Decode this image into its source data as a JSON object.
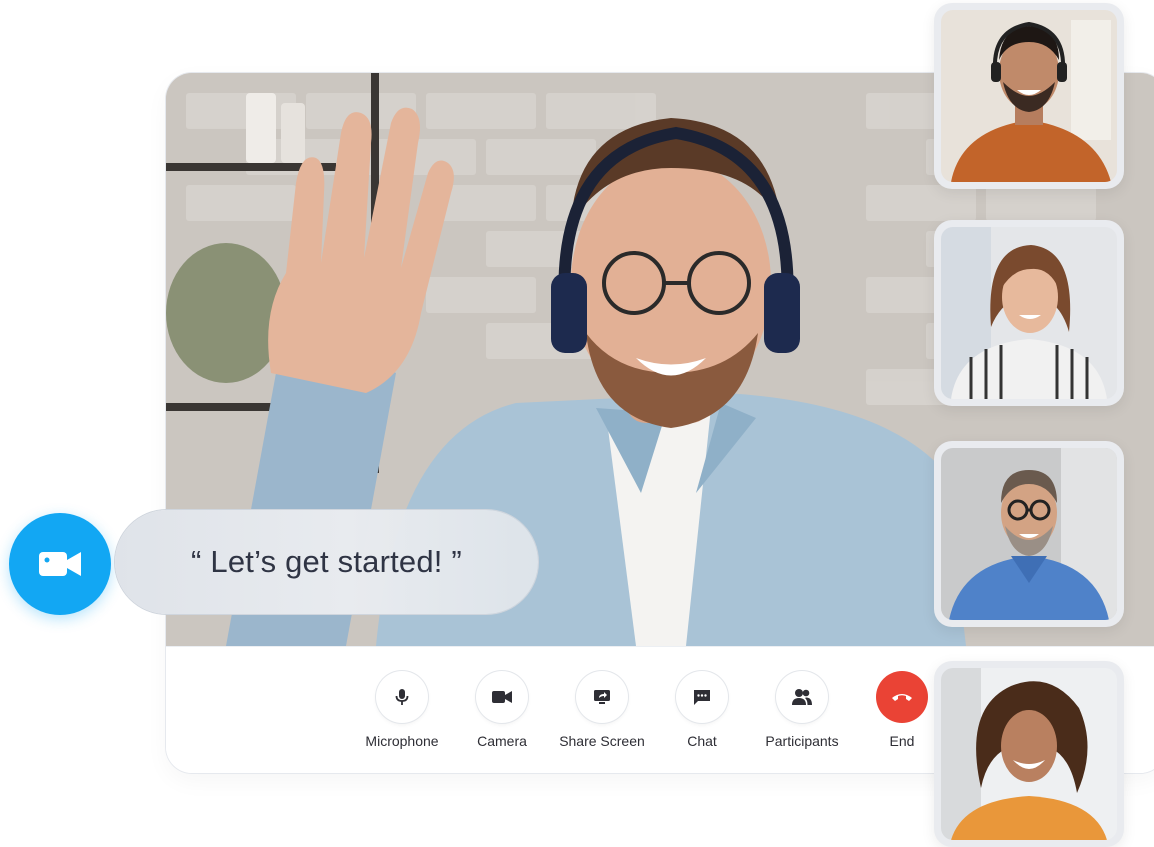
{
  "caption": {
    "text": "“ Let’s get started! ”"
  },
  "controls": [
    {
      "label": "Microphone",
      "icon": "microphone-icon"
    },
    {
      "label": "Camera",
      "icon": "camera-icon"
    },
    {
      "label": "Share Screen",
      "icon": "share-screen-icon"
    },
    {
      "label": "Chat",
      "icon": "chat-icon"
    },
    {
      "label": "Participants",
      "icon": "participants-icon"
    },
    {
      "label": "End",
      "icon": "end-call-icon"
    }
  ],
  "colors": {
    "accent": "#12a7f3",
    "end_call": "#ea4335",
    "icon": "#2e2e35"
  }
}
